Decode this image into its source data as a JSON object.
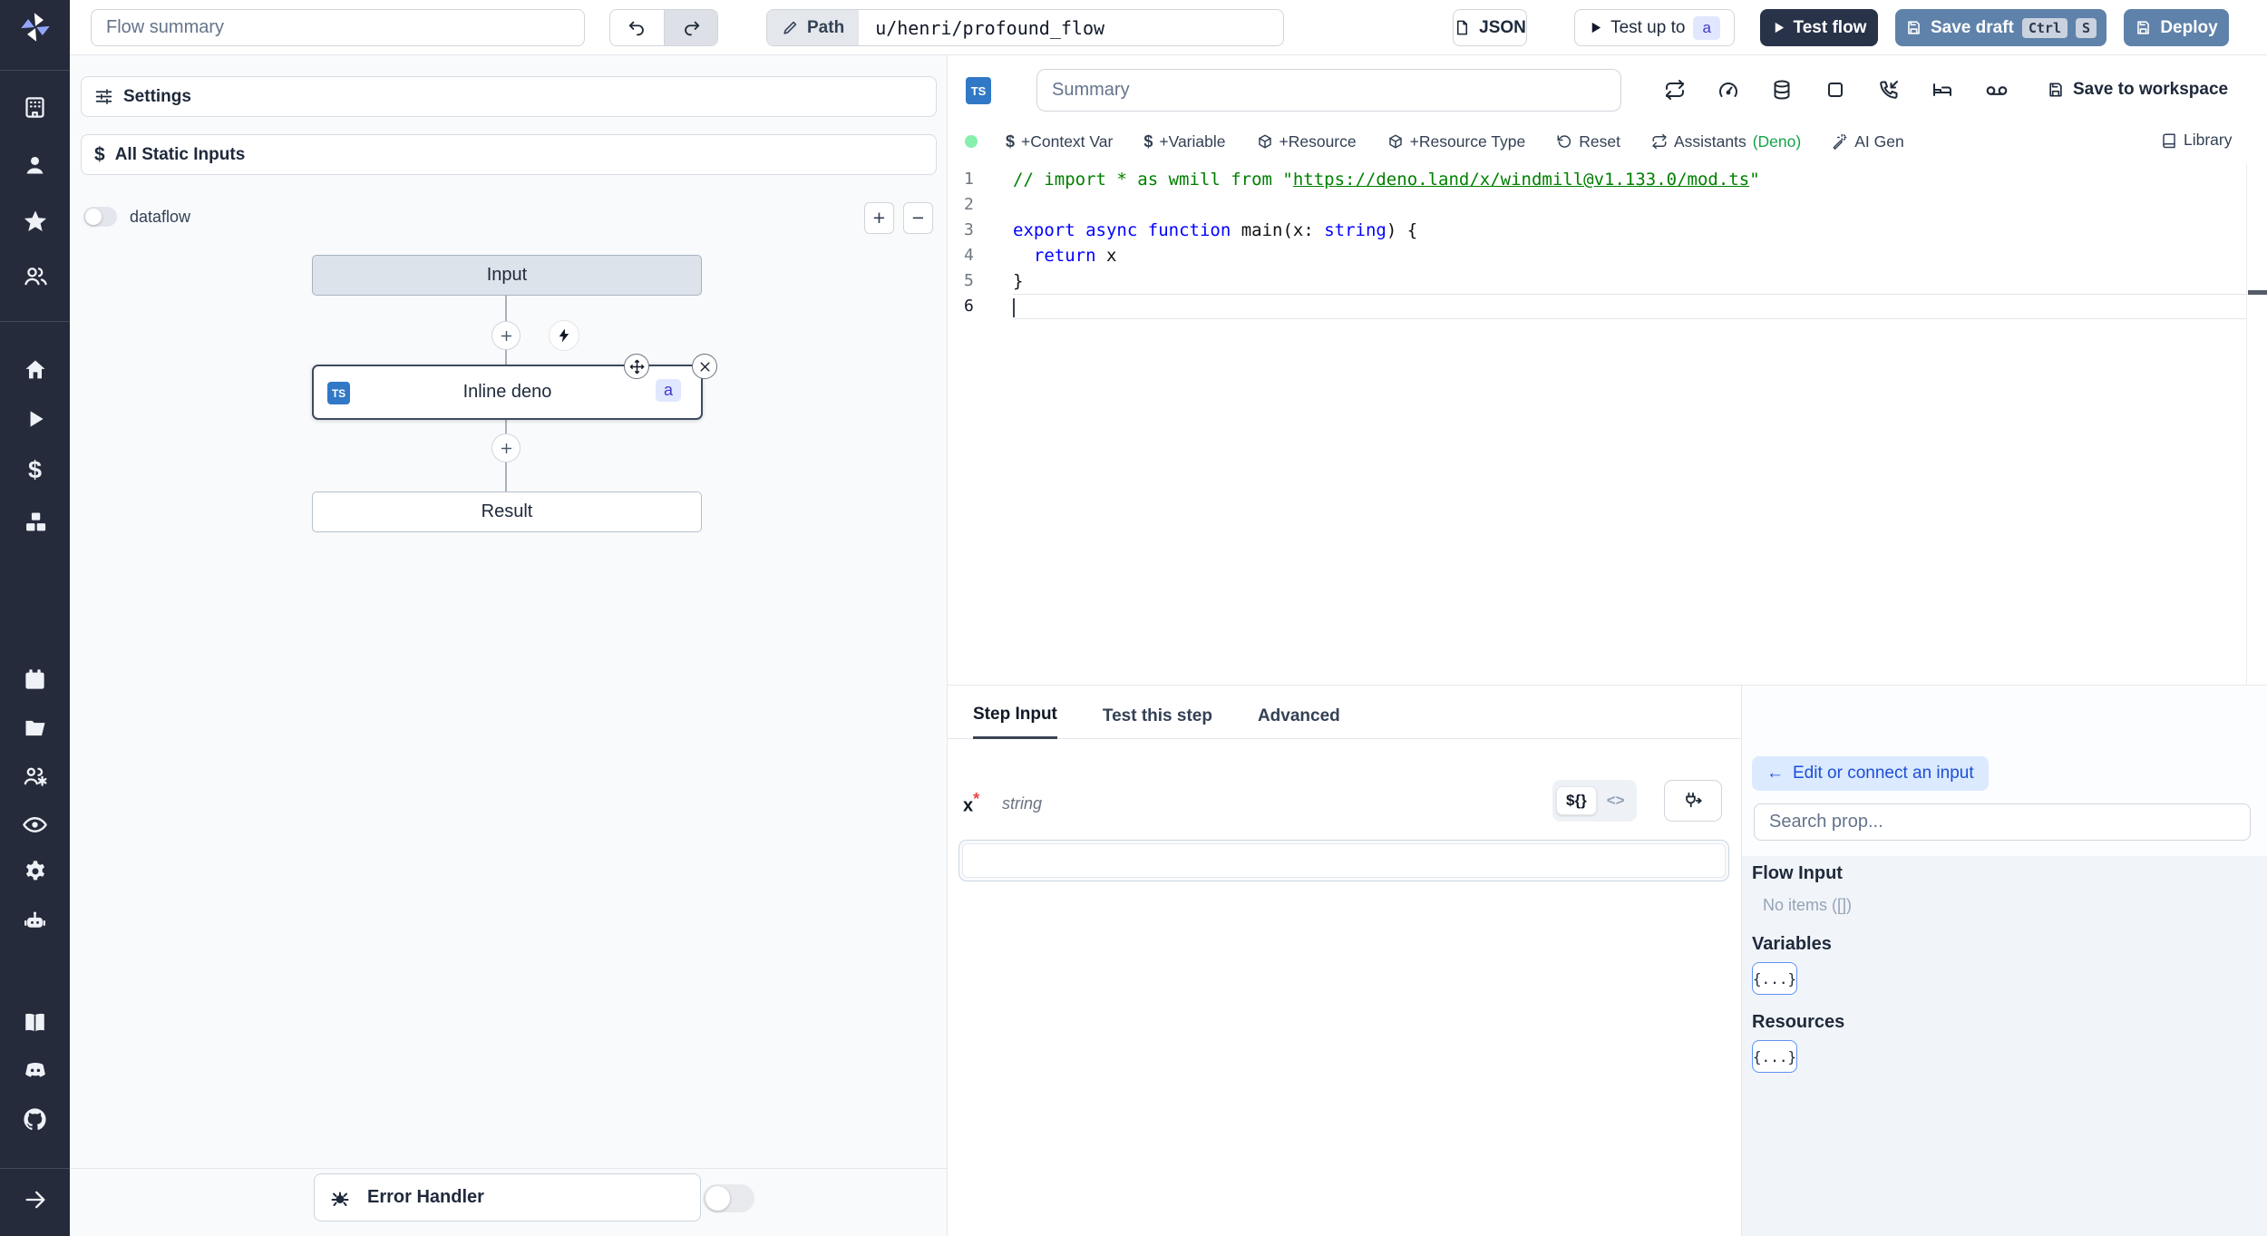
{
  "topbar": {
    "flow_summary_placeholder": "Flow summary",
    "path_label": "Path",
    "path_value": "u/henri/profound_flow",
    "json_button": "JSON",
    "test_up_to": "Test up to",
    "test_up_to_badge": "a",
    "test_flow": "Test flow",
    "save_draft": "Save draft",
    "kbd_ctrl": "Ctrl",
    "kbd_s": "S",
    "deploy": "Deploy"
  },
  "flow_panel": {
    "settings": "Settings",
    "all_static_inputs": "All Static Inputs",
    "dataflow_label": "dataflow",
    "zoom_in": "+",
    "zoom_out": "−",
    "nodes": {
      "input": "Input",
      "step_title": "Inline deno",
      "step_lang": "TS",
      "step_id_badge": "a",
      "result": "Result"
    },
    "error_handler": "Error Handler"
  },
  "editor": {
    "lang_badge": "TS",
    "summary_placeholder": "Summary",
    "save_to_workspace": "Save to workspace",
    "toolbar": {
      "dollar": "$",
      "context_var": "+Context Var",
      "variable": "+Variable",
      "resource": "+Resource",
      "resource_type": "+Resource Type",
      "reset": "Reset",
      "assistants": "Assistants",
      "assistants_lang": "(Deno)",
      "ai_gen": "AI Gen",
      "library": "Library"
    },
    "code": {
      "lines": [
        {
          "n": "1",
          "tokens": [
            {
              "c": "cm",
              "t": "// import * as wmill from \""
            },
            {
              "c": "lk",
              "t": "https://deno.land/x/windmill@v1.133.0/mod.ts"
            },
            {
              "c": "cm",
              "t": "\""
            }
          ]
        },
        {
          "n": "2",
          "tokens": []
        },
        {
          "n": "3",
          "tokens": [
            {
              "c": "kw",
              "t": "export"
            },
            {
              "c": "pl",
              "t": " "
            },
            {
              "c": "kw",
              "t": "async"
            },
            {
              "c": "pl",
              "t": " "
            },
            {
              "c": "kw",
              "t": "function"
            },
            {
              "c": "pl",
              "t": " main(x: "
            },
            {
              "c": "kw",
              "t": "string"
            },
            {
              "c": "pl",
              "t": ") {"
            }
          ]
        },
        {
          "n": "4",
          "tokens": [
            {
              "c": "pl",
              "t": "  "
            },
            {
              "c": "kw",
              "t": "return"
            },
            {
              "c": "pl",
              "t": " x"
            }
          ]
        },
        {
          "n": "5",
          "tokens": [
            {
              "c": "pl",
              "t": "}"
            }
          ]
        },
        {
          "n": "6",
          "tokens": [],
          "cursor": true,
          "current": true
        }
      ]
    }
  },
  "step_panel": {
    "tabs": [
      "Step Input",
      "Test this step",
      "Advanced"
    ],
    "active_tab": "Step Input",
    "field_name": "x",
    "required_marker": "*",
    "field_type": "string",
    "toggle_expr": "${}",
    "toggle_code": "<>"
  },
  "connect_panel": {
    "back_arrow": "←",
    "edit_button_label": "Edit or connect an input",
    "search_placeholder": "Search prop...",
    "flow_input_heading": "Flow Input",
    "no_items": "No items ([])",
    "variables_heading": "Variables",
    "resources_heading": "Resources",
    "brace_chip": "{...}"
  },
  "icons": {
    "sidebar": [
      "windmill-logo",
      "workspace-icon",
      "user-icon",
      "star-icon",
      "groups-icon",
      "home-icon",
      "runs-icon",
      "variables-icon",
      "resources-icon",
      "schedules-icon",
      "folders-icon",
      "workers-icon",
      "audit-icon",
      "settings-icon",
      "assistant-icon",
      "docs-icon",
      "discord-icon",
      "github-icon",
      "expand-icon"
    ],
    "editor_header": [
      "cache-icon",
      "concurrency-icon",
      "database-icon",
      "stop-icon",
      "phone-incoming-icon",
      "sleep-icon",
      "voicemail-icon"
    ]
  },
  "colors": {
    "sidebar_bg": "#252b3b",
    "dark_button": "#283349",
    "steel_button": "#5f82aa",
    "ts_badge": "#3178c6",
    "indigo_badge_bg": "#e0e7ff",
    "edit_pill_bg": "#dbeafe",
    "edit_pill_text": "#1d4ed8",
    "assistants_lang_green": "#16a34a",
    "green_dot": "#86efac",
    "code_keyword": "#0000ff",
    "code_comment": "#008000"
  }
}
